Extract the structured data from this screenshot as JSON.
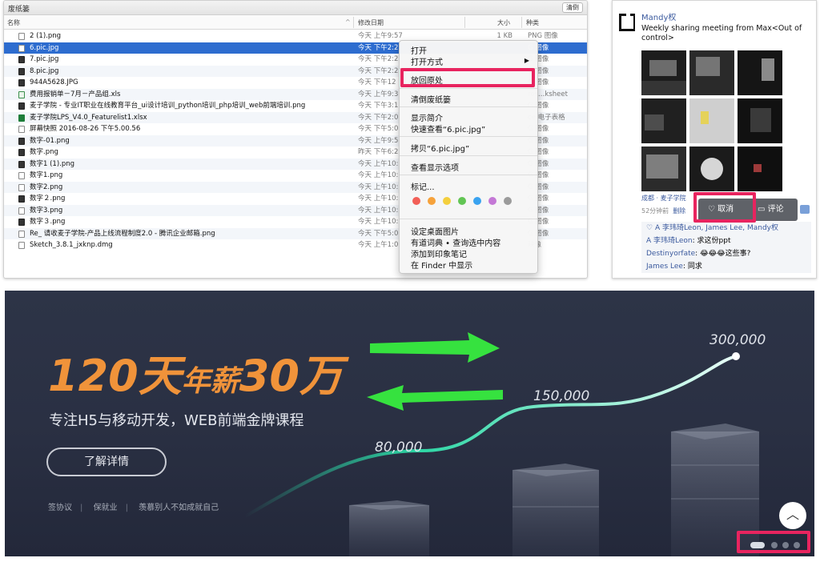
{
  "finder": {
    "title": "废纸篓",
    "clear_button": "清倒",
    "columns": {
      "name": "名称",
      "date": "修改日期",
      "size": "大小",
      "kind": "种类"
    },
    "rows": [
      {
        "name": "2 (1).png",
        "date": "今天 上午9:57",
        "size": "1 KB",
        "kind": "PNG 图像"
      },
      {
        "name": "6.pic.jpg",
        "date": "今天 下午2:2",
        "size": "",
        "kind": "G 图像"
      },
      {
        "name": "7.pic.jpg",
        "date": "今天 下午2:2",
        "size": "",
        "kind": "G 图像"
      },
      {
        "name": "8.pic.jpg",
        "date": "今天 下午2:2",
        "size": "",
        "kind": "G 图像"
      },
      {
        "name": "944A5628.JPG",
        "date": "今天 下午12",
        "size": "",
        "kind": "G 图像"
      },
      {
        "name": "费用报销单－7月－产品组.xls",
        "date": "今天 上午9:3",
        "size": "",
        "kind": "ros…ksheet"
      },
      {
        "name": "麦子学院 - 专业IT职业在线教育平台_ui设计培训_python培训_php培训_web前端培训.png",
        "date": "今天 下午3:1",
        "size": "",
        "kind": "G 图像"
      },
      {
        "name": "麦子学院LPS_V4.0_Featurelist1.xlsx",
        "date": "今天 下午2:0",
        "size": "",
        "kind": "ce 电子表格"
      },
      {
        "name": "屏幕快照 2016-08-26 下午5.00.56",
        "date": "今天 下午5:0",
        "size": "",
        "kind": "G 图像"
      },
      {
        "name": "数字-01.png",
        "date": "今天 上午9:5",
        "size": "",
        "kind": "G 图像"
      },
      {
        "name": "数字.png",
        "date": "昨天 下午6:2",
        "size": "",
        "kind": "G 图像"
      },
      {
        "name": "数字1 (1).png",
        "date": "今天 上午10:",
        "size": "",
        "kind": "G 图像"
      },
      {
        "name": "数字1.png",
        "date": "今天 上午10:",
        "size": "",
        "kind": "G 图像"
      },
      {
        "name": "数字2.png",
        "date": "今天 上午10:",
        "size": "",
        "kind": "G 图像"
      },
      {
        "name": "数字２.png",
        "date": "今天 上午10:",
        "size": "",
        "kind": "G 图像"
      },
      {
        "name": "数字3.png",
        "date": "今天 上午10:",
        "size": "",
        "kind": "G 图像"
      },
      {
        "name": "数字３.png",
        "date": "今天 上午10:",
        "size": "",
        "kind": "G 图像"
      },
      {
        "name": "Re_ 请收麦子学院-产品上线流程制度2.0 - 腾讯企业邮箱.png",
        "date": "今天 下午5:0",
        "size": "",
        "kind": "G 图像"
      },
      {
        "name": "Sketch_3.8.1_jxknp.dmg",
        "date": "今天 上午1:0",
        "size": "",
        "kind": "映像"
      }
    ],
    "context_menu": {
      "open": "打开",
      "open_with": "打开方式",
      "put_back": "放回原处",
      "empty_trash": "清倒废纸篓",
      "get_info": "显示简介",
      "quick_look": "快速查看“6.pic.jpg”",
      "copy": "拷贝“6.pic.jpg”",
      "view_options": "查看显示选项",
      "tags": "标记...",
      "tag_colors": [
        "#f25f57",
        "#f6a23b",
        "#f4cf3d",
        "#62c554",
        "#3aa3f0",
        "#c478d6",
        "#9b9b9b"
      ],
      "set_desktop": "设定桌面图片",
      "dictionary": "有道词典 • 查询选中内容",
      "evernote": "添加到印象笔记",
      "show_in_finder": "在 Finder 中显示"
    }
  },
  "social": {
    "user": "Mandy权",
    "message": "Weekly sharing meeting from Max<Out of control>",
    "location": "成都 · 麦子学院",
    "time": "52分钟前",
    "delete": "删除",
    "cancel_like": "取消",
    "comment": "评论",
    "likes": "A 李玮琦Leon, James Lee, Mandy权",
    "comments": [
      {
        "author": "A 李玮琦Leon",
        "text": ": 求这份ppt"
      },
      {
        "author": "Destinyorfate",
        "text": ": 😂😂😂这些事?"
      },
      {
        "author": "James Lee",
        "text": ": 同求"
      }
    ]
  },
  "banner": {
    "headline_a": "120天",
    "headline_b": "年薪",
    "headline_c": "30万",
    "subtitle": "专注H5与移动开发，WEB前端金牌课程",
    "cta": "了解详情",
    "footer": [
      "签协议",
      "保就业",
      "羡慕别人不如成就自己"
    ],
    "values": [
      "80,000",
      "150,000",
      "300,000"
    ],
    "scroll_top_icon": "arrow-up-icon",
    "accent_color": "#f0933a",
    "arrow_color": "#36e23f"
  }
}
